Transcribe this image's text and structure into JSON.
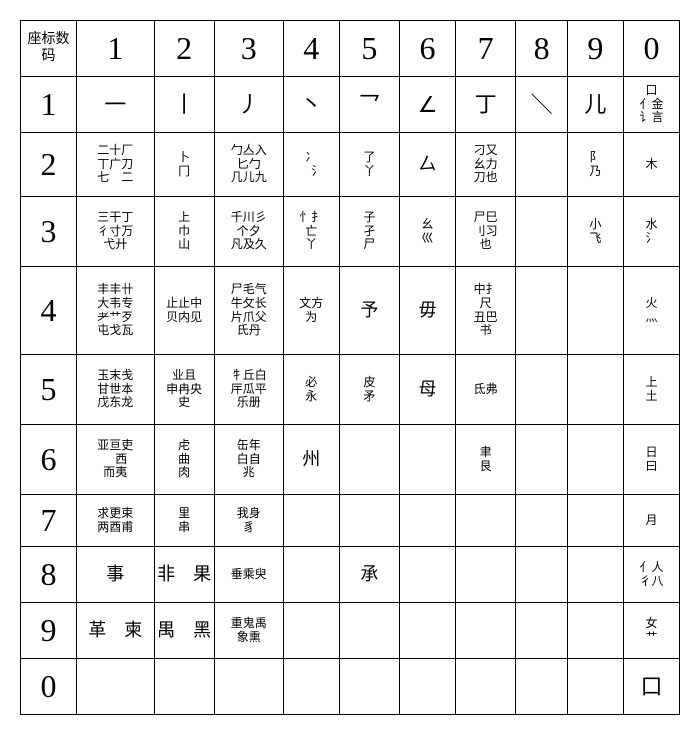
{
  "header": {
    "corner": "座标\n数码",
    "cols": [
      "1",
      "2",
      "3",
      "4",
      "5",
      "6",
      "7",
      "8",
      "9",
      "0"
    ]
  },
  "rows": [
    {
      "head": "1",
      "c1": "一",
      "c2": "丨",
      "c3": "丿",
      "c4": "丶",
      "c5": "乛",
      "c6": "∠",
      "c7": "丁",
      "c8": "＼",
      "c9": "儿",
      "c0": "口\n亻金\n讠言"
    },
    {
      "head": "2",
      "c1": "二十厂\n丅广刀\n七　二",
      "c2": "卜\n冂",
      "c3": "勹亼入\n匕勹\n几儿九",
      "c4": "冫\n　氵",
      "c5": "了\n丫",
      "c6": "厶",
      "c7": "刁又\n幺力\n刀也",
      "c8": "",
      "c9": "阝\n乃",
      "c0": "木"
    },
    {
      "head": "3",
      "c1": "三干丁\n彳寸万\n弋廾",
      "c2": "上\n巾\n山",
      "c3": "千川彡\n个夕\n凡及久",
      "c4": "忄扌\n亡\n丫",
      "c5": "子\n孑\n尸",
      "c6": "幺\n巛",
      "c7": "尸巳\n刂习\n也",
      "c8": "",
      "c9": "小\n飞",
      "c0": "水\n氵"
    },
    {
      "head": "4",
      "c1": "丰丰卄\n大韦专\n耂艹歹\n屯戈瓦",
      "c2": "止止中\n贝内见",
      "c3": "尸毛气\n牛攵长\n片爪父\n氏丹",
      "c4": "文方\n为",
      "c5": "予",
      "c6": "毋",
      "c7": "中扌\n尺\n丑巴\n书",
      "c8": "",
      "c9": "",
      "c0": "火\n灬"
    },
    {
      "head": "5",
      "c1": "玉末戋\n甘世本\n戊东龙",
      "c2": "业且\n申冉央\n史",
      "c3": "牜丘白\n厈瓜平\n乐册",
      "c4": "必\n永",
      "c5": "皮\n矛",
      "c6": "母",
      "c7": "氐弗",
      "c8": "",
      "c9": "",
      "c0": "上\n土"
    },
    {
      "head": "6",
      "c1": "亚亘吏\n　西\n而夷",
      "c2": "虍\n曲\n肉",
      "c3": "缶年\n白自\n兆",
      "c4": "州",
      "c5": "",
      "c6": "",
      "c7": "聿\n艮",
      "c8": "",
      "c9": "",
      "c0": "日\n曰"
    },
    {
      "head": "7",
      "c1": "求更束\n两酉甫",
      "c2": "里\n串",
      "c3": "我身\n豸",
      "c4": "",
      "c5": "",
      "c6": "",
      "c7": "",
      "c8": "",
      "c9": "",
      "c0": "月"
    },
    {
      "head": "8",
      "c1": "事",
      "c2": "非　果",
      "c3": "垂乘臾",
      "c4": "",
      "c5": "承",
      "c6": "",
      "c7": "",
      "c8": "",
      "c9": "",
      "c0": "亻人\n彳八"
    },
    {
      "head": "9",
      "c1": "革　柬",
      "c2": "禺　黑",
      "c3": "重鬼禹\n象熏",
      "c4": "",
      "c5": "",
      "c6": "",
      "c7": "",
      "c8": "",
      "c9": "",
      "c0": "女\n艹"
    },
    {
      "head": "0",
      "c1": "",
      "c2": "",
      "c3": "",
      "c4": "",
      "c5": "",
      "c6": "",
      "c7": "",
      "c8": "",
      "c9": "",
      "c0": "口"
    }
  ]
}
